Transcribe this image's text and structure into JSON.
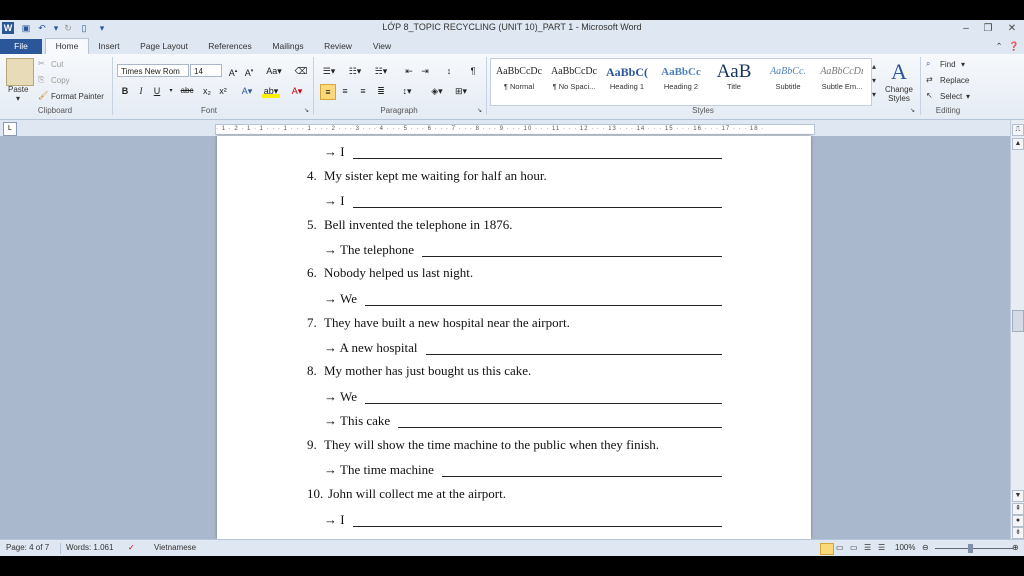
{
  "window": {
    "title": "LỚP 8_TOPIC RECYCLING (UNIT 10)_PART 1  -  Microsoft Word",
    "quick_access": [
      "word-icon",
      "save-icon",
      "undo-icon",
      "redo-icon",
      "new-icon",
      "customize-icon"
    ]
  },
  "tabs": [
    "File",
    "Home",
    "Insert",
    "Page Layout",
    "References",
    "Mailings",
    "Review",
    "View"
  ],
  "ribbon": {
    "clipboard": {
      "paste": "Paste",
      "cut": "Cut",
      "copy": "Copy",
      "format_painter": "Format Painter",
      "label": "Clipboard"
    },
    "font": {
      "name": "Times New Rom",
      "size": "14",
      "label": "Font"
    },
    "paragraph": {
      "label": "Paragraph"
    },
    "styles": {
      "label": "Styles",
      "items": [
        {
          "sample": "AaBbCcDc",
          "name": "¶ Normal"
        },
        {
          "sample": "AaBbCcDc",
          "name": "¶ No Spaci..."
        },
        {
          "sample": "AaBbC(",
          "name": "Heading 1"
        },
        {
          "sample": "AaBbCc",
          "name": "Heading 2"
        },
        {
          "sample": "AaB",
          "name": "Title"
        },
        {
          "sample": "AaBbCc.",
          "name": "Subtitle"
        },
        {
          "sample": "AaBbCcDı",
          "name": "Subtle Em..."
        }
      ],
      "change_styles": "Change Styles"
    },
    "editing": {
      "find": "Find",
      "replace": "Replace",
      "select": "Select",
      "label": "Editing"
    }
  },
  "ruler": "· 1 · 2 · 1 · 1 · · · 1 · · · 1 · · · 2 · · · 3 · · · 4 · · · 5 · · · 6 · · · 7 · · · 8 · · · 9 · · · 10 · · · 11 · · · 12 · · · 13 · · · 14 · · · 15 · · · 16 · · · 17 · · · 18 ·",
  "document": {
    "lines": [
      {
        "kind": "answer",
        "prefix": "→ I"
      },
      {
        "kind": "question",
        "num": "4.",
        "text": "My sister kept me waiting for half an hour."
      },
      {
        "kind": "answer",
        "prefix": "→ I"
      },
      {
        "kind": "question",
        "num": "5.",
        "text": "Bell invented the telephone in 1876."
      },
      {
        "kind": "answer",
        "prefix": "→ The telephone"
      },
      {
        "kind": "question",
        "num": "6.",
        "text": "Nobody helped us last night."
      },
      {
        "kind": "answer",
        "prefix": "→ We"
      },
      {
        "kind": "question",
        "num": "7.",
        "text": "They have built a new hospital near the airport."
      },
      {
        "kind": "answer",
        "prefix": "→ A new hospital"
      },
      {
        "kind": "question",
        "num": "8.",
        "text": "My mother has just bought us this cake."
      },
      {
        "kind": "answer",
        "prefix": "→ We"
      },
      {
        "kind": "answer",
        "prefix": "→ This cake"
      },
      {
        "kind": "question",
        "num": "9.",
        "text": "They will show the time machine to the public when they finish."
      },
      {
        "kind": "answer",
        "prefix": "→ The time machine"
      },
      {
        "kind": "question",
        "num": "10.",
        "text": "John will collect me at the airport."
      },
      {
        "kind": "answer",
        "prefix": "→ I"
      }
    ]
  },
  "status": {
    "page": "Page: 4 of 7",
    "words": "Words: 1.061",
    "language": "Vietnamese",
    "zoom": "100%"
  }
}
